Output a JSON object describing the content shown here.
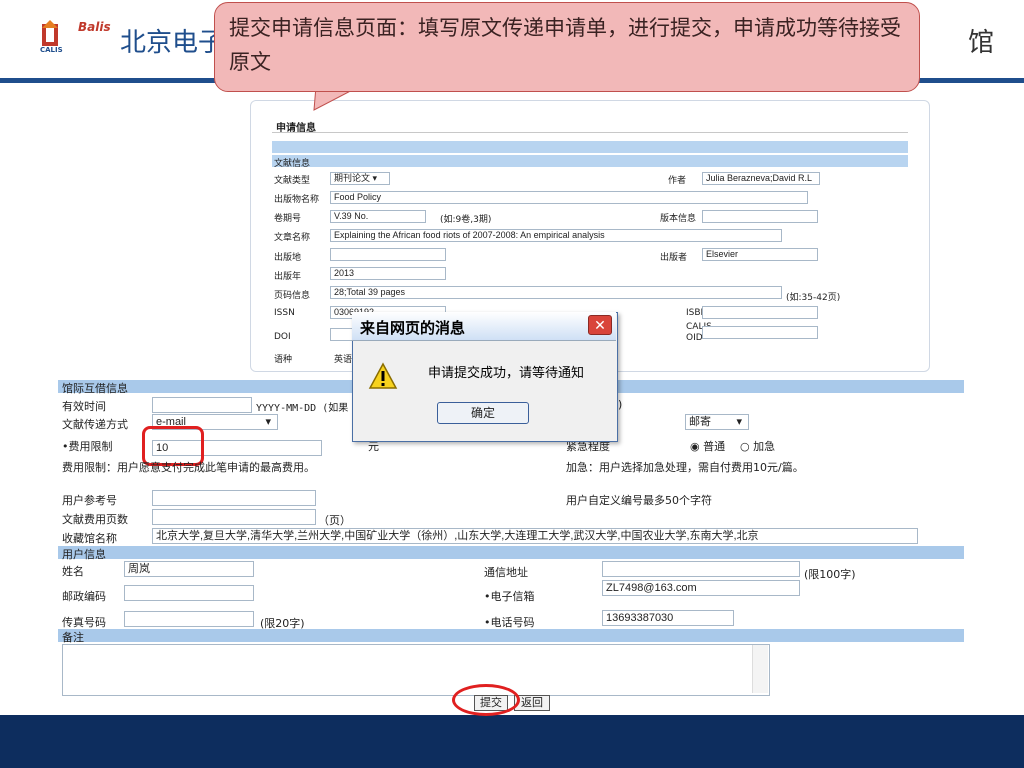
{
  "header": {
    "logo_label": "Balis",
    "logo_sub": "CALIS",
    "title_visible": "北京电子",
    "right_fragment": "馆"
  },
  "callout": {
    "text": "提交申请信息页面：填写原文传递申请单，进行提交，申请成功等待接受原文"
  },
  "upper_form": {
    "title": "申请信息",
    "section": "文献信息",
    "doc_type_label": "文献类型",
    "doc_type_value": "期刊论文",
    "author_label": "作者",
    "author_value": "Julia Berazneva;David R.L",
    "publication_label": "出版物名称",
    "publication_value": "Food Policy",
    "volume_label": "卷期号",
    "volume_value": "V.39 No.",
    "volume_hint": "(如:9卷,3期)",
    "edition_label": "版本信息",
    "article_label": "文章名称",
    "article_value": "Explaining the African food riots of 2007-2008: An empirical analysis",
    "place_label": "出版地",
    "publisher_label": "出版者",
    "publisher_value": "Elsevier",
    "year_label": "出版年",
    "year_value": "2013",
    "pages_label": "页码信息",
    "pages_value": "28;Total 39 pages",
    "pages_hint": "(如:35-42页)",
    "issn_label": "ISSN",
    "issn_value": "03069192",
    "isbn_label": "ISBN",
    "doi_label": "DOI",
    "calis_label": "CALIS-OID",
    "lang_label": "语种",
    "lang_value": "英语"
  },
  "dialog": {
    "title": "来自网页的消息",
    "close_glyph": "✕",
    "message": "申请提交成功，请等待通知",
    "ok_label": "确定"
  },
  "lower_form": {
    "section_ill": "馆际互借信息",
    "valid_label": "有效时间",
    "valid_hint": "YYYY-MM-DD (如果",
    "valid_tail": ")",
    "delivery_label": "文献传递方式",
    "delivery_value": "e-mail",
    "mail_value": "邮寄",
    "fee_label": "•费用限制",
    "fee_value": "10",
    "fee_unit": "元",
    "urgency_label": "紧急程度",
    "urgency_normal": "普通",
    "urgency_rush": "加急",
    "fee_note": "费用限制：用户愿意支付完成此笔申请的最高费用。",
    "rush_note": "加急：用户选择加急处理，需自付费用10元/篇。",
    "ref_label": "用户参考号",
    "ref_note": "用户自定义编号最多50个字符",
    "pages_fee_label": "文献费用页数",
    "pages_unit": "（页）",
    "library_label": "收藏馆名称",
    "library_value": "北京大学,复旦大学,清华大学,兰州大学,中国矿业大学（徐州）,山东大学,大连理工大学,武汉大学,中国农业大学,东南大学,北京",
    "section_user": "用户信息",
    "name_label": "姓名",
    "name_value": "周岚",
    "address_label": "通信地址",
    "address_hint": "(限100字)",
    "zip_label": "邮政编码",
    "email_label": "•电子信箱",
    "email_value": "ZL7498@163.com",
    "fax_label": "传真号码",
    "fax_hint": "(限20字)",
    "phone_label": "•电话号码",
    "phone_value": "13693387030",
    "remark_label": "备注",
    "submit_label": "提交",
    "back_label": "返回"
  },
  "colors": {
    "header_blue": "#1f4e8c",
    "footer_navy": "#0d2d5e",
    "callout_fill": "#f2b8b8",
    "highlight_red": "#e02020",
    "band_blue": "#a9c9ea"
  }
}
